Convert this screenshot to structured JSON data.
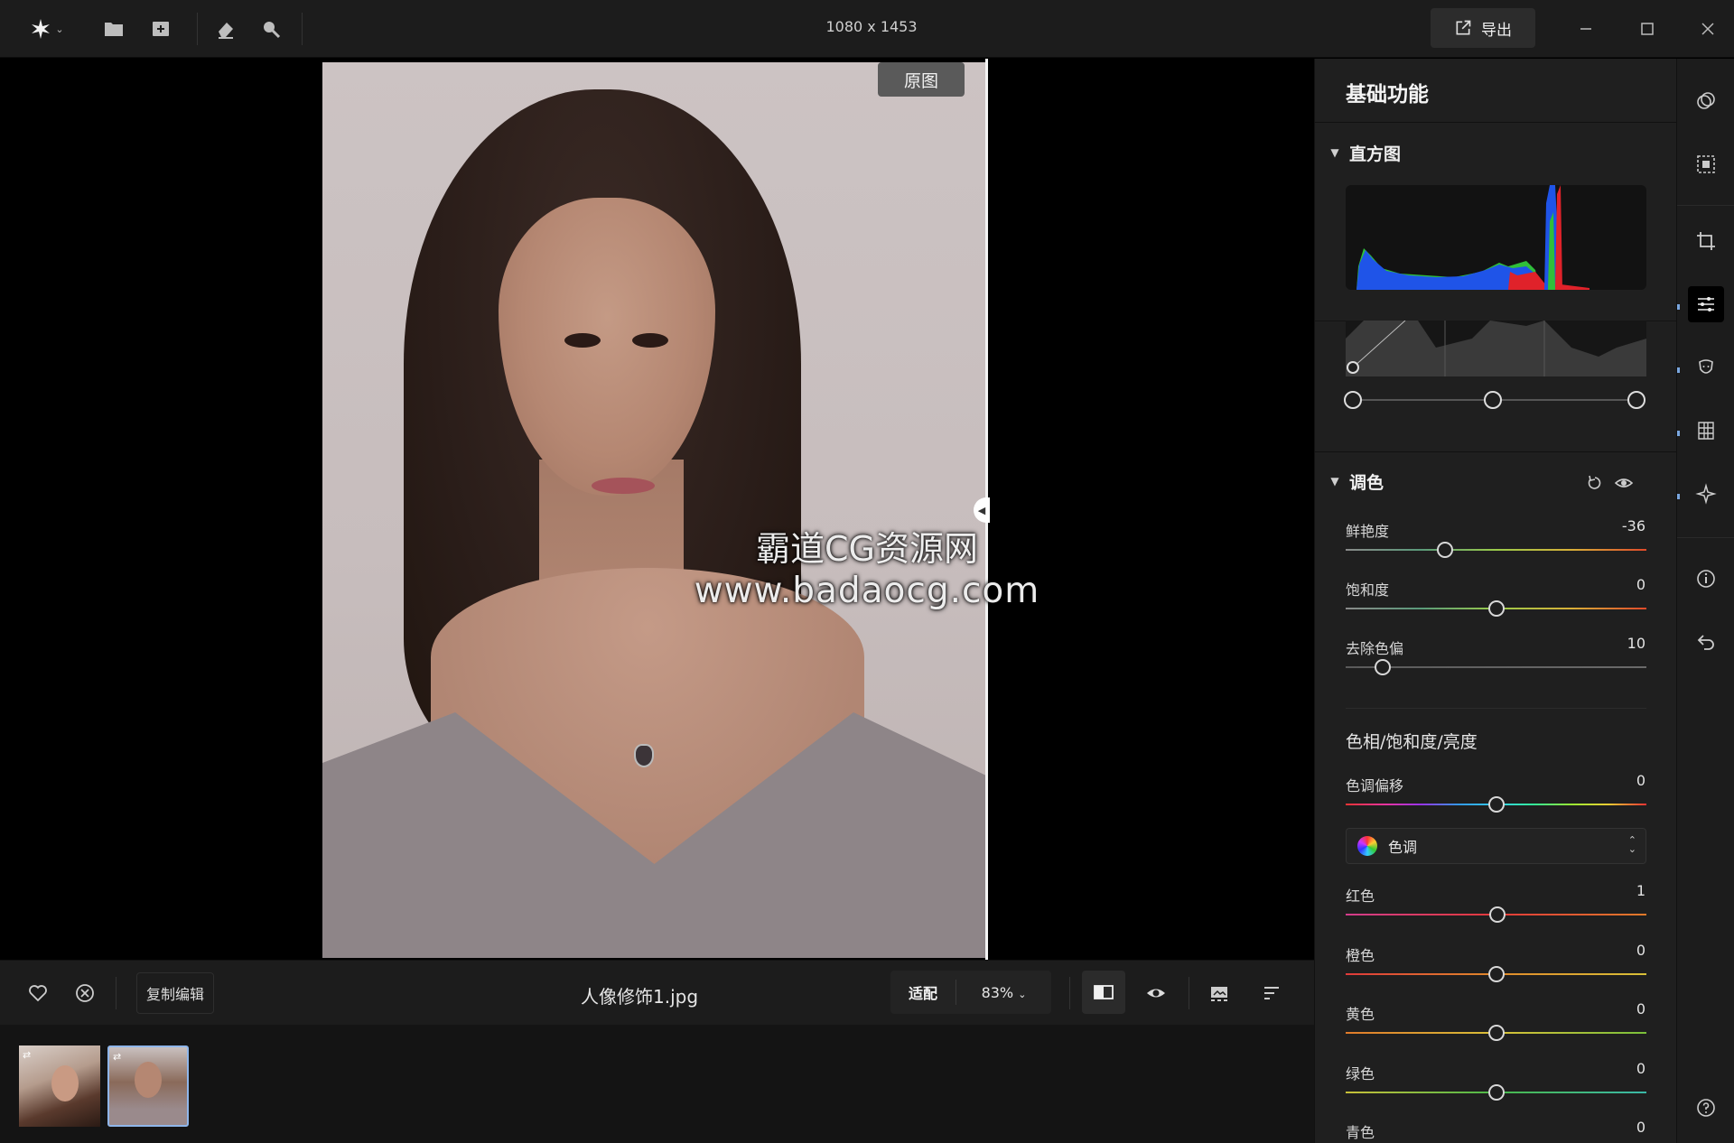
{
  "window": {
    "image_dimensions": "1080 x 1453",
    "export_label": "导出"
  },
  "toolbar_icons": [
    "app-logo-icon",
    "folder-icon",
    "add-image-icon",
    "eraser-icon",
    "search-icon"
  ],
  "canvas": {
    "original_tag": "原图",
    "watermark_line1": "霸道CG资源网",
    "watermark_line2": "www.badaocg.com"
  },
  "bottom": {
    "copy_edit_label": "复制编辑",
    "filename": "人像修饰1.jpg",
    "fit_label": "适配",
    "zoom_label": "83%"
  },
  "panel": {
    "title": "基础功能",
    "histogram_title": "直方图",
    "color_section_title": "调色",
    "sliders": [
      {
        "label": "鲜艳度",
        "value": "-36",
        "min": -100,
        "max": 100,
        "num": -36,
        "track": "sat"
      },
      {
        "label": "饱和度",
        "value": "0",
        "min": -100,
        "max": 100,
        "num": 0,
        "track": "sat"
      },
      {
        "label": "去除色偏",
        "value": "10",
        "min": 0,
        "max": 100,
        "num": 10,
        "track": "gray"
      }
    ],
    "hsl_title": "色相/饱和度/亮度",
    "hue_shift": {
      "label": "色调偏移",
      "value": "0",
      "num": 0
    },
    "hue_select_label": "色调",
    "color_sliders": [
      {
        "label": "红色",
        "value": "1",
        "num": 1,
        "track": "red"
      },
      {
        "label": "橙色",
        "value": "0",
        "num": 0,
        "track": "orange"
      },
      {
        "label": "黄色",
        "value": "0",
        "num": 0,
        "track": "yellow"
      },
      {
        "label": "绿色",
        "value": "0",
        "num": 0,
        "track": "green"
      },
      {
        "label": "青色",
        "value": "0",
        "num": 0,
        "track": "cyan"
      }
    ]
  },
  "colors": {
    "accent": "#7aa7e0",
    "panel_bg": "#1f1f1f",
    "topbar_bg": "#1c1c1c"
  }
}
